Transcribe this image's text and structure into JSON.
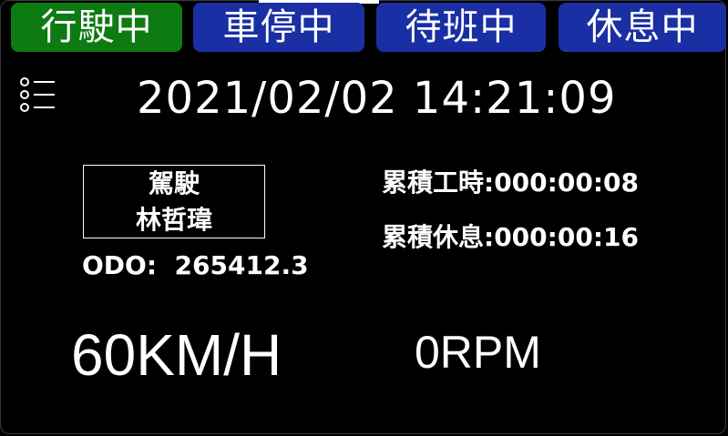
{
  "status_tabs": [
    {
      "label": "行駛中",
      "state": "active",
      "color": "#0d7a12"
    },
    {
      "label": "車停中",
      "state": "idle",
      "color": "#1a2fa3"
    },
    {
      "label": "待班中",
      "state": "idle",
      "color": "#1a2fa3"
    },
    {
      "label": "休息中",
      "state": "idle",
      "color": "#1a2fa3"
    }
  ],
  "header": {
    "menu_icon": "list-menu-icon",
    "datetime": "2021/02/02 14:21:09"
  },
  "driver": {
    "role": "駕駛",
    "name": "林哲瑋"
  },
  "odometer": {
    "label": "ODO:",
    "value": "265412.3"
  },
  "stats": {
    "work_label": "累積工時:",
    "work_value": "000:00:08",
    "rest_label": "累積休息:",
    "rest_value": "000:00:16"
  },
  "gauges": {
    "speed": "60KM/H",
    "rpm": "0RPM"
  }
}
